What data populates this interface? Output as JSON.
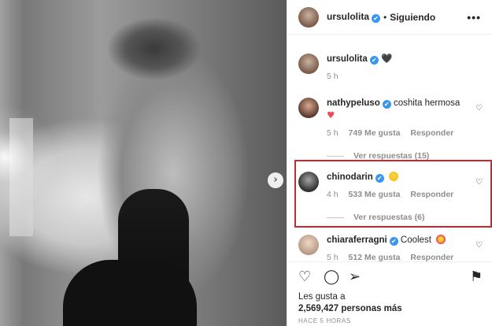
{
  "post": {
    "next_arrow": "›"
  },
  "header": {
    "username": "ursulolita",
    "verified_mark": "✔",
    "dot": "•",
    "follow_label": "Siguiendo",
    "more_label": "•••"
  },
  "caption": {
    "username": "ursulolita",
    "text": "🖤",
    "time": "5 h"
  },
  "comments": [
    {
      "username": "nathypeluso",
      "text": "coshita hermosa",
      "extra": "♥",
      "time": "5 h",
      "likes": "749 Me gusta",
      "reply": "Responder",
      "replies": "Ver respuestas (15)"
    },
    {
      "username": "chinodarin",
      "text": "",
      "time": "4 h",
      "likes": "533 Me gusta",
      "reply": "Responder",
      "replies": "Ver respuestas (6)"
    },
    {
      "username": "chiaraferragni",
      "text": "Coolest",
      "time": "5 h",
      "likes": "512 Me gusta",
      "reply": "Responder"
    }
  ],
  "icons": {
    "like": "♡",
    "comment": "◯",
    "share": "➢",
    "save": "⚑",
    "small_heart": "♡"
  },
  "likes": {
    "prefix": "Les gusta a",
    "count": "2,569,427 personas más"
  },
  "timestamp": "HACE 5 HORAS",
  "colors": {
    "highlight": "#d0252c",
    "verified": "#3897f0",
    "muted": "#8e8e8e"
  }
}
